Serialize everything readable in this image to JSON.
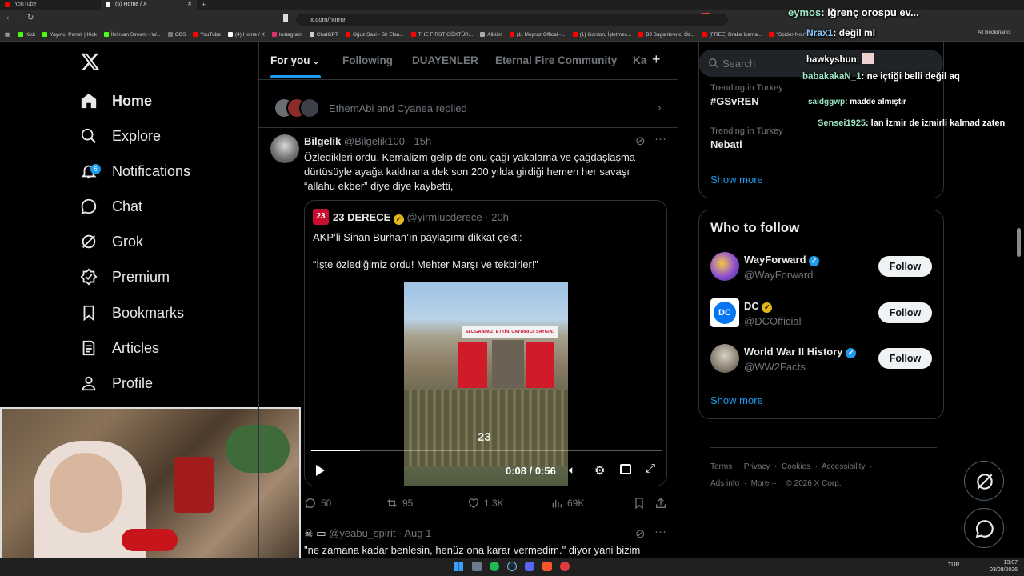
{
  "browser": {
    "tabs": [
      {
        "title": "YouTube",
        "color": "#ff0000"
      },
      {
        "title": "(6) Home / X",
        "color": "#ffffff"
      }
    ],
    "url": "x.com/home",
    "bookmarks": [
      {
        "label": "Kick",
        "color": "#53fc18"
      },
      {
        "label": "Yayıncı Paneli | Kick",
        "color": "#53fc18"
      },
      {
        "label": "İlkinsan Stream - W...",
        "color": "#53fc18"
      },
      {
        "label": "OBS",
        "color": "#777777"
      },
      {
        "label": "YouTube",
        "color": "#ff0000"
      },
      {
        "label": "(4) Home / X",
        "color": "#ffffff"
      },
      {
        "label": "Instagram",
        "color": "#e1306c"
      },
      {
        "label": "ChatGPT",
        "color": "#cccccc"
      },
      {
        "label": "Oğuz Sasi - Bir Efsa...",
        "color": "#ff0000"
      },
      {
        "label": "THE FIRST GÖKTÜR...",
        "color": "#ff0000"
      },
      {
        "label": "Albüm",
        "color": "#aaaaaa"
      },
      {
        "label": "(1) Mepraz Offical -...",
        "color": "#ff0000"
      },
      {
        "label": "(1) Gordon, İşletmec...",
        "color": "#ff0000"
      },
      {
        "label": "BJ Bagantırenci Öz...",
        "color": "#ff0000"
      },
      {
        "label": "(FREE) Drake Icema...",
        "color": "#ff0000"
      },
      {
        "label": "\"Spider-Noir\" - True...",
        "color": "#ff0000"
      }
    ],
    "all_bookmarks": "All Bookmarks"
  },
  "nav": {
    "items": [
      {
        "key": "home",
        "label": "Home",
        "icon": "home-icon"
      },
      {
        "key": "explore",
        "label": "Explore",
        "icon": "search-icon"
      },
      {
        "key": "notifications",
        "label": "Notifications",
        "icon": "bell-icon",
        "badge": "6"
      },
      {
        "key": "chat",
        "label": "Chat",
        "icon": "chat-icon"
      },
      {
        "key": "grok",
        "label": "Grok",
        "icon": "grok-icon"
      },
      {
        "key": "premium",
        "label": "Premium",
        "icon": "premium-icon"
      },
      {
        "key": "bookmarks",
        "label": "Bookmarks",
        "icon": "bookmark-icon"
      },
      {
        "key": "articles",
        "label": "Articles",
        "icon": "articles-icon"
      },
      {
        "key": "profile",
        "label": "Profile",
        "icon": "profile-icon"
      }
    ]
  },
  "feed_tabs": [
    "For you",
    "Following",
    "DUAYENLER",
    "Eternal Fire Community",
    "Ka"
  ],
  "replied_row": {
    "text": "EthemAbi and Cyanea replied"
  },
  "tweet": {
    "name": "Bilgelik",
    "handle": "@Bilgelik100",
    "time": "15h",
    "text": "Özledikleri ordu, Kemalizm gelip de onu çağı yakalama ve çağdaşlaşma dürtüsüyle ayağa kaldırana dek son 200 yılda girdiği hemen her savaşı “allahu ekber” diye diye kaybetti,",
    "quote": {
      "name": "23 DERECE",
      "handle": "@yirmiucderece",
      "time": "20h",
      "line1": "AKP’li Sinan Burhan’ın paylaşımı dikkat çekti:",
      "line2": "“İşte özlediğimiz ordu! Mehter Marşı ve tekbirler!”",
      "video": {
        "banner": "SLOGANIMIZ: ETKİN, CAYDIRICI, SAYGIN.",
        "time": "0:08 / 0:56",
        "watermark": "23",
        "progress": 0.14
      }
    },
    "stats": {
      "replies": "50",
      "reposts": "95",
      "likes": "1.3K",
      "views": "69K"
    }
  },
  "next_tweet": {
    "handle": "@yeabu_spirit",
    "time": "Aug 1",
    "text": "\"ne zamana kadar benlesin, henüz ona karar vermedim.\" diyor yani bizim"
  },
  "search": {
    "placeholder": "Search"
  },
  "trends": {
    "items": [
      {
        "context": "Trending in Turkey",
        "topic": "#GSvREN"
      },
      {
        "context": "Trending in Turkey",
        "topic": "Nebati"
      }
    ],
    "show_more": "Show more"
  },
  "who_to_follow": {
    "title": "Who to follow",
    "items": [
      {
        "name": "WayForward",
        "handle": "@WayForward",
        "verified": "blue"
      },
      {
        "name": "DC",
        "handle": "@DCOfficial",
        "verified": "gold"
      },
      {
        "name": "World War II History",
        "handle": "@WW2Facts",
        "verified": "blue"
      }
    ],
    "follow_label": "Follow",
    "show_more": "Show more"
  },
  "footer": {
    "links": [
      "Terms",
      "Privacy",
      "Cookies",
      "Accessibility",
      "Ads info",
      "More ···"
    ],
    "copyright": "© 2026 X Corp."
  },
  "chat_overlay": [
    {
      "user": "eymos",
      "message": "iğrenç orospu ev..."
    },
    {
      "user": "Nrax1",
      "message": "değil mi"
    },
    {
      "user": "hawkyshun",
      "message": ""
    },
    {
      "user": "babakakaN_1",
      "message": "ne içtiği belli değil aq"
    },
    {
      "user": "saidggwp",
      "message": "madde almıştır"
    },
    {
      "user": "Sensei1925",
      "message": "lan İzmir de izmirli kalmad zaten"
    }
  ],
  "taskbar": {
    "lang": "TUR",
    "time": "13:07",
    "date": "03/08/2026"
  }
}
